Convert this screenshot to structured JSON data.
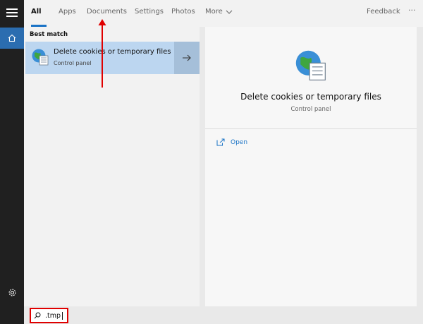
{
  "tabs": [
    {
      "label": "All"
    },
    {
      "label": "Apps"
    },
    {
      "label": "Documents"
    },
    {
      "label": "Settings"
    },
    {
      "label": "Photos"
    },
    {
      "label": "More"
    }
  ],
  "topbar": {
    "feedback_label": "Feedback",
    "ellipsis": "···"
  },
  "best_match_heading": "Best match",
  "result": {
    "title": "Delete cookies or temporary files",
    "subtitle": "Control panel"
  },
  "detail": {
    "title": "Delete cookies or temporary files",
    "subtitle": "Control panel",
    "open_label": "Open"
  },
  "search": {
    "value": ".tmp"
  },
  "colors": {
    "accent": "#1a73c6",
    "selection": "#bcd6f0",
    "annotation": "#e00000"
  }
}
